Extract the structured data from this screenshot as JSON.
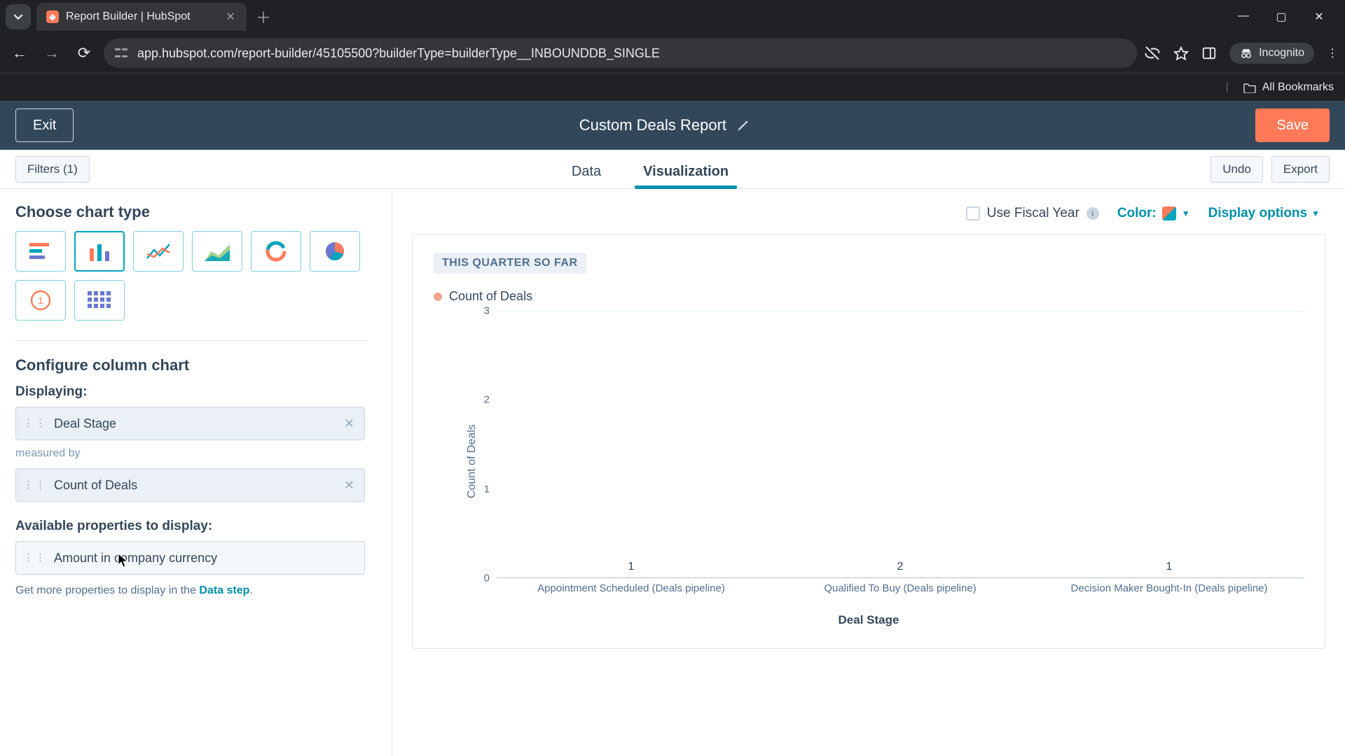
{
  "browser": {
    "tab_title": "Report Builder | HubSpot",
    "url": "app.hubspot.com/report-builder/45105500?builderType=builderType__INBOUNDDB_SINGLE",
    "incognito_label": "Incognito",
    "bookmarks_label": "All Bookmarks"
  },
  "header": {
    "exit": "Exit",
    "title": "Custom Deals Report",
    "save": "Save"
  },
  "toolbar": {
    "filters": "Filters (1)",
    "tab_data": "Data",
    "tab_visualization": "Visualization",
    "undo": "Undo",
    "export": "Export"
  },
  "sidebar": {
    "choose_title": "Choose chart type",
    "configure_title": "Configure column chart",
    "displaying_label": "Displaying:",
    "dimension": "Deal Stage",
    "measured_by": "measured by",
    "measure": "Count of Deals",
    "available_title": "Available properties to display:",
    "available_prop": "Amount in company currency",
    "help_prefix": "Get more properties to display in the ",
    "help_link": "Data step"
  },
  "canvas": {
    "fiscal": "Use Fiscal Year",
    "color": "Color:",
    "display_options": "Display options",
    "badge": "THIS QUARTER SO FAR",
    "legend": "Count of Deals",
    "y_title": "Count of Deals",
    "x_title": "Deal Stage"
  },
  "chart_data": {
    "type": "bar",
    "title": "THIS QUARTER SO FAR",
    "xlabel": "Deal Stage",
    "ylabel": "Count of Deals",
    "ylim": [
      0,
      3
    ],
    "y_ticks": [
      0,
      1,
      2,
      3
    ],
    "categories": [
      "Appointment Scheduled (Deals pipeline)",
      "Qualified To Buy (Deals pipeline)",
      "Decision Maker Bought-In (Deals pipeline)"
    ],
    "values": [
      1,
      2,
      1
    ],
    "series_name": "Count of Deals",
    "color": "#f5a58c"
  }
}
